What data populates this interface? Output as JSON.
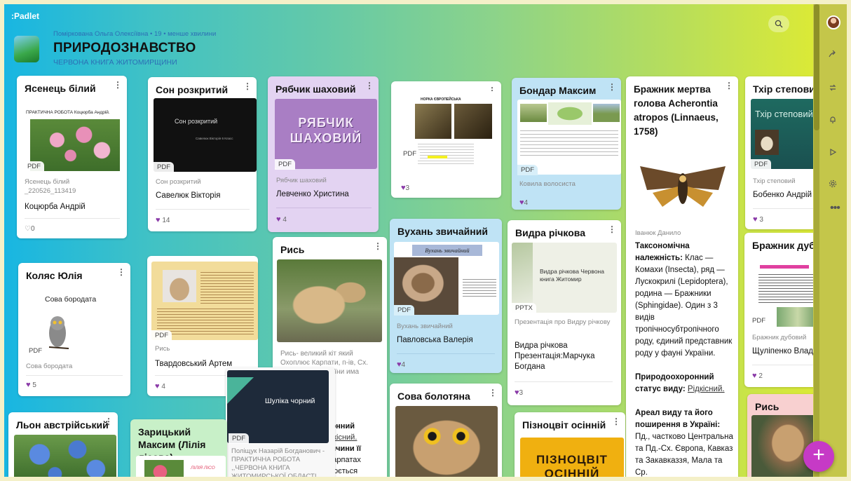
{
  "app": {
    "logo": ":Padlet"
  },
  "header": {
    "meta": "Поміркована Ольга Олексіївна • 19 • менше хвилини",
    "title": "ПРИРОДОЗНАВСТВО",
    "subtitle": "ЧЕРВОНА КНИГА ЖИТОМИРЩИНИ"
  },
  "cards": {
    "yasenets": {
      "title": "Ясенець білий",
      "doc_head": "ПРАКТИЧНА РОБОТА Коцюрба Андрій.",
      "badge": "PDF",
      "cap1": "Ясенець білий",
      "cap2": "_220526_113419",
      "author": "Коцюрба Андрій",
      "likes": "0"
    },
    "son": {
      "title": "Сон розкритий",
      "slide_title": "Сон розкритий",
      "slide_sub": "Савелюк Вікторія 6 Класс",
      "badge": "PDF",
      "cap": "Сон розкритий",
      "author": "Савелюк Вікторія",
      "likes": "14"
    },
    "ryabchyk": {
      "title": "Рябчик шаховий",
      "img_text1": "РЯБЧИК",
      "img_text2": "ШАХОВИЙ",
      "badge": "PDF",
      "cap": "Рябчик шаховий",
      "author": "Левченко Христина",
      "likes": "4"
    },
    "norka": {
      "doc_title": "НОРКА ЄВРОПЕЙСЬКА",
      "badge": "PDF",
      "likes": "3"
    },
    "bondar": {
      "title": "Бондар Максим",
      "badge": "PDF",
      "cap": "Ковила волосиста",
      "likes": "4"
    },
    "brazhnyk": {
      "title": "Бражник мертва голова Acherontia atropos (Linnaeus, 1758)",
      "author": "Іванюк Данило",
      "t1": "Таксономічна належність:",
      "t1v": " Клас — Комахи (Insecta), ряд — Лускокрилі (Lepidoptera), родина — Бражники (Sphingidae). Один з 3 видів тропічносубтропічного роду, єдиний представник роду у фауні України.",
      "t2": "Природоохоронний статус виду:",
      "t2v": "Рідкісний.",
      "t3": "Ареал виду та його поширення в Україні:",
      "t3v": " Пд., частково Центральна та Пд.-Сх. Європа, Кавказ та Закавказзя, Мала та Ср."
    },
    "tkhir": {
      "title": "Тхір степовий",
      "img_title": "Тхір степовий",
      "badge": "PDF",
      "cap": "Тхір степовий",
      "author": "Бобенко Андрій",
      "likes": "3"
    },
    "kolyas": {
      "title": "Коляс Юлія",
      "doc_title": "Сова бородата",
      "badge": "PDF",
      "cap": "Сова бородата",
      "likes": "5"
    },
    "rys_doc": {
      "badge": "PDF",
      "cap": "Рись",
      "author": "Твардовський Артем",
      "likes": "4"
    },
    "rys_big": {
      "title": "Рись",
      "cap": "Рись- великий кіт який Охоплює Карпати, п-ів, Сх. зини, Сибір України има зиторії",
      "t1": "оронний",
      "t1v": "Рідкісний.",
      "t2": "причини її",
      "t2v": "в Карпатах дінюється"
    },
    "vukhan": {
      "title": "Вухань звичайний",
      "img_title": "Вухань звичайний",
      "badge": "PDF",
      "cap": "Вухань звичайний",
      "author": "Павловська Валерія",
      "likes": "4"
    },
    "vydra": {
      "title": "Видра річкова",
      "slide_text": "Видра річкова Червона книга Житомир",
      "badge": "PPTX",
      "cap": "Презентація про Видру річкову",
      "author": "Видра річкова Презентація:Марчука Богдана",
      "likes": "3"
    },
    "bd": {
      "title": "Бражник дубовий",
      "badge": "PDF",
      "cap": "Бражник дубовий",
      "author": "Щуліпенко Владислав",
      "likes": "2"
    },
    "lon": {
      "title": "Льон австрійський"
    },
    "zaritskyi": {
      "title": "Зарицький Максим (Лілія лісова)",
      "img_text": "ЛІЛІЯ ЛІСО"
    },
    "shulika": {
      "slide_title": "Шуліка чорний",
      "badge": "PDF",
      "cap": "Поліщук Назарій Богданович - ПРАКТИЧНА РОБОТА ,,ЧЕРВОНА КНИГА ЖИТОМИРСЬКОЇ ОБЛАСТІ"
    },
    "sova": {
      "title": "Сова болотяна"
    },
    "piznotsvit": {
      "title": "Пізноцвіт осінній",
      "img_text1": "ПІЗНОЦВІТ",
      "img_text2": "ОСІННІЙ"
    },
    "rys_right": {
      "title": "Рись"
    }
  }
}
